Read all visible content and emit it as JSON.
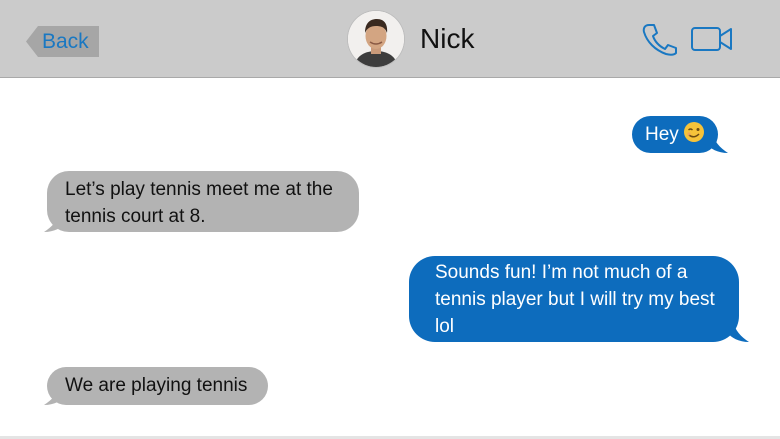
{
  "header": {
    "back_label": "Back",
    "contact_name": "Nick",
    "avatar": "contact-avatar-photo",
    "icons": {
      "call": "phone-icon",
      "video": "video-camera-icon"
    },
    "background": "#cbcbcb",
    "accent": "#1a78c2"
  },
  "messages": [
    {
      "direction": "outgoing",
      "text": "Hey",
      "emoji": "winking-face"
    },
    {
      "direction": "incoming",
      "text": "Let’s play tennis meet me at the tennis court at 8."
    },
    {
      "direction": "outgoing",
      "text": "Sounds fun! I’m not much of a tennis player but I will try my best lol"
    },
    {
      "direction": "incoming",
      "text": "We are playing tennis"
    }
  ],
  "colors": {
    "outgoing_bubble": "#0d6cbd",
    "incoming_bubble": "#b3b3b3",
    "outgoing_text": "#ffffff",
    "incoming_text": "#111111"
  }
}
